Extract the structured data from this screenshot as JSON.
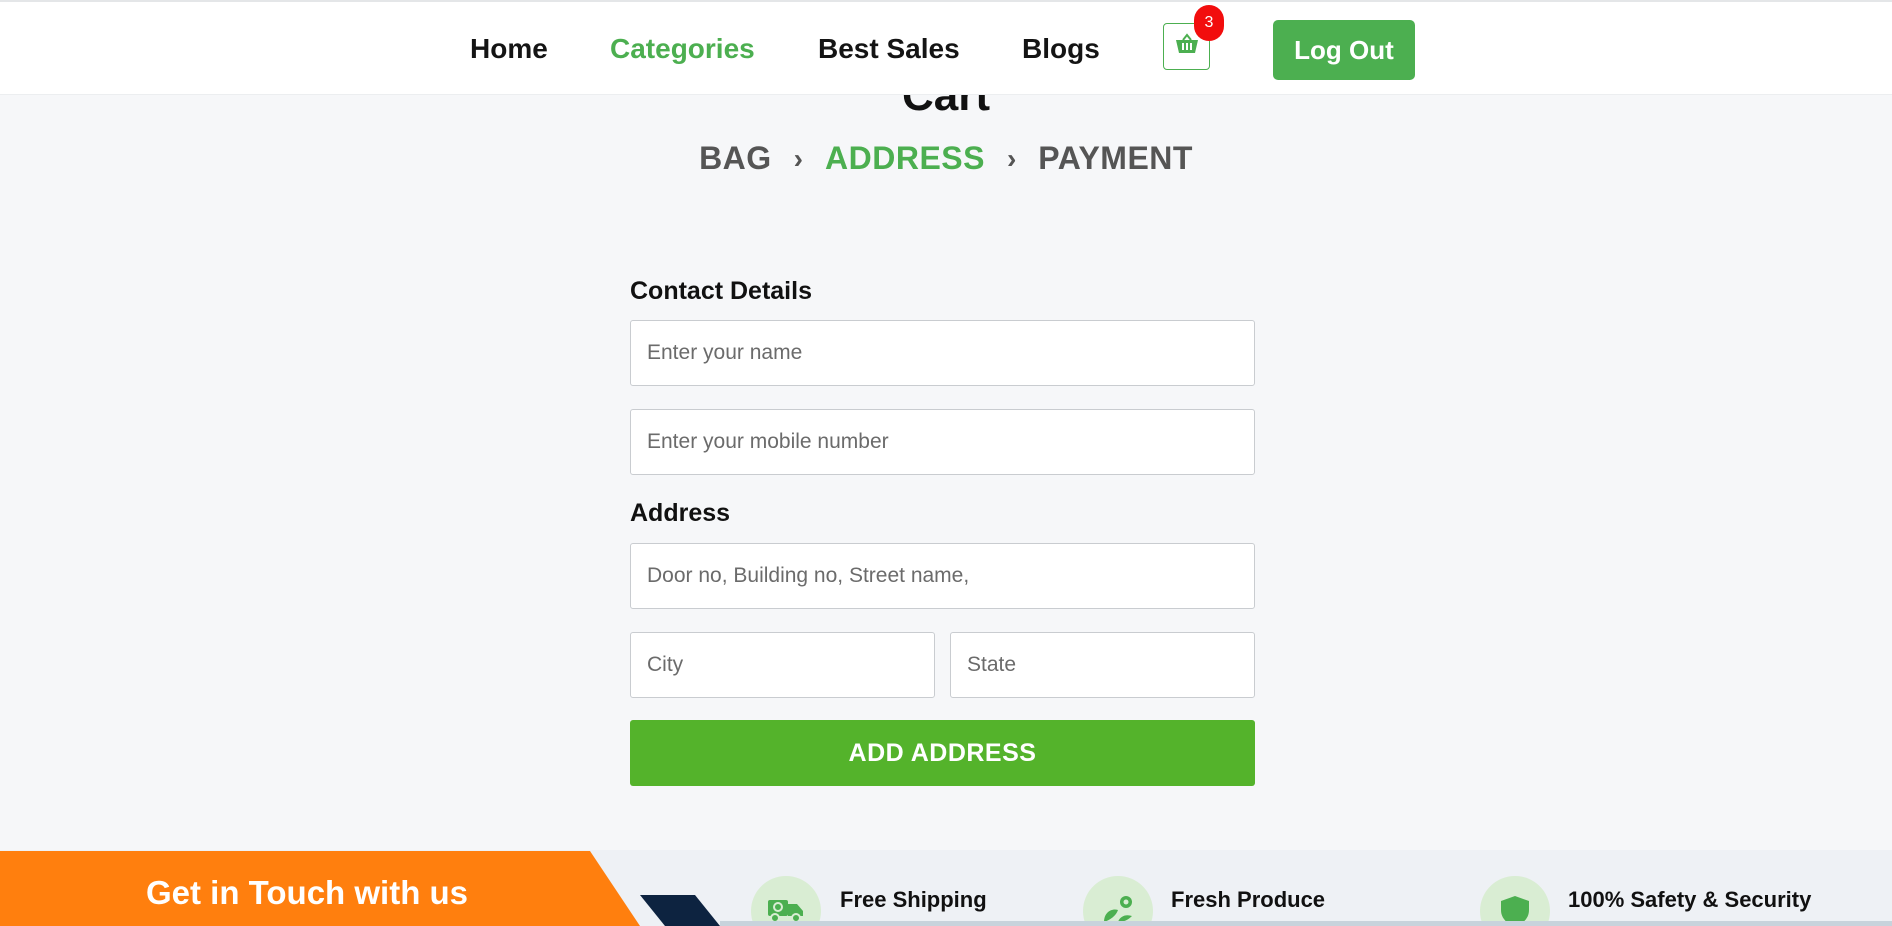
{
  "nav": {
    "home": "Home",
    "categories": "Categories",
    "best_sales": "Best Sales",
    "blogs": "Blogs",
    "cart_count": "3",
    "logout": "Log Out"
  },
  "page": {
    "title": "Cart"
  },
  "steps": {
    "bag": "BAG",
    "address": "ADDRESS",
    "payment": "PAYMENT",
    "separator": "›"
  },
  "form": {
    "contact_label": "Contact Details",
    "name_placeholder": "Enter your name",
    "mobile_placeholder": "Enter your mobile number",
    "address_label": "Address",
    "street_placeholder": "Door no, Building no, Street name,",
    "city_placeholder": "City",
    "state_placeholder": "State",
    "submit_label": "ADD ADDRESS"
  },
  "footer": {
    "get_in_touch": "Get in Touch with us",
    "features": [
      {
        "label": "Free Shipping",
        "icon": "truck-icon"
      },
      {
        "label": "Fresh Produce",
        "icon": "leaf-gear-icon"
      },
      {
        "label": "100% Safety & Security",
        "icon": "shield-icon"
      }
    ]
  },
  "colors": {
    "accent": "#4caf50",
    "button_green": "#54b32b",
    "badge_red": "#f20d0d",
    "banner_orange": "#ff7f0e",
    "background": "#f6f7f9"
  }
}
